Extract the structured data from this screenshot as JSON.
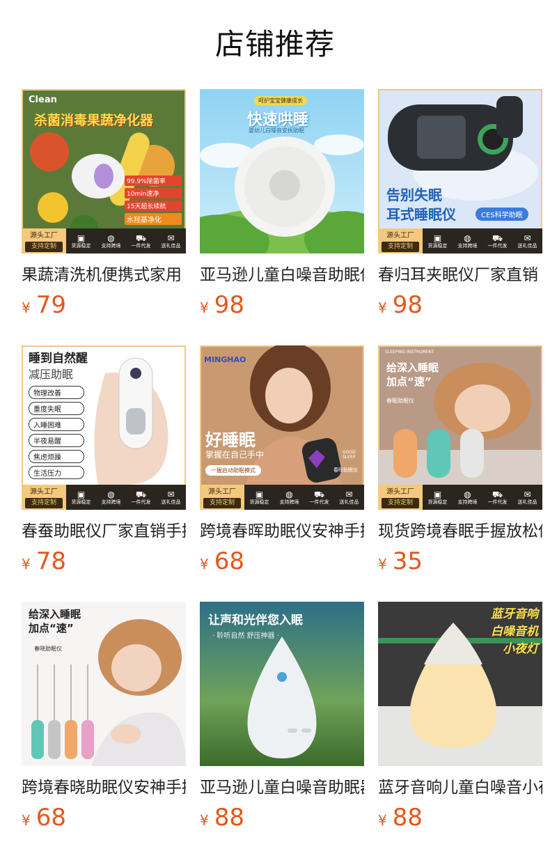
{
  "page": {
    "title": "店铺推荐"
  },
  "currency": "¥",
  "badge": {
    "line1": "源头工厂",
    "line2": "支持定制",
    "features": [
      {
        "icon": "box-icon",
        "glyph": "▣",
        "label": "货源稳定"
      },
      {
        "icon": "globe-icon",
        "glyph": "◍",
        "label": "支持跨境"
      },
      {
        "icon": "truck-icon",
        "glyph": "⛟",
        "label": "一件代发"
      },
      {
        "icon": "gift-icon",
        "glyph": "🎁",
        "label": "送礼佳品"
      }
    ]
  },
  "products": [
    {
      "name": "果蔬清洗机便携式家用",
      "price": "79",
      "overlay": {
        "brand": "Clean",
        "headline": "杀菌消毒果蔬净化器",
        "tags": [
          "99.9%除菌率",
          "10min速净",
          "15天超长续航",
          "水羟基净化"
        ]
      }
    },
    {
      "name": "亚马逊儿童白噪音助眠仪",
      "price": "98",
      "overlay": {
        "top": "呵护宝宝健康成长",
        "headline": "快速哄睡",
        "sub": "婴幼儿白噪音安抚助眠"
      }
    },
    {
      "name": "春归耳夹眠仪厂家直销",
      "price": "98",
      "overlay": {
        "headline1": "告别失眠",
        "headline2": "耳式睡眠仪",
        "tag": "CES科学助眠"
      }
    },
    {
      "name": "春蚕助眠仪厂家直销手握",
      "price": "78",
      "overlay": {
        "headline1": "睡到自然醒",
        "headline2": "减压助眠",
        "tags": [
          "物理改善",
          "重度失眠",
          "入睡困难",
          "半夜易醒",
          "焦虑烦躁",
          "生活压力"
        ]
      }
    },
    {
      "name": "跨境春晖助眠仪安神手握",
      "price": "68",
      "overlay": {
        "brand": "MINGHAO",
        "headline": "好睡眠",
        "sub": "掌握在自己手中",
        "button": "一握启动助眠模式",
        "tag": "春晖助眠仪",
        "device": "GOOD SLEEP."
      }
    },
    {
      "name": "现货跨境春眠手握放松仪",
      "price": "35",
      "overlay": {
        "top": "SLEEPING INSTRUMENT",
        "headline1": "给深入睡眠",
        "headline2": "加点“速”",
        "sub": "春眠助眠仪"
      }
    },
    {
      "name": "跨境春晓助眠仪安神手握",
      "price": "68",
      "overlay": {
        "headline1": "给深入睡眠",
        "headline2": "加点“速”",
        "sub": "春晓助眠仪"
      }
    },
    {
      "name": "亚马逊儿童白噪音助眠器",
      "price": "88",
      "overlay": {
        "headline": "让声和光伴您入眠",
        "sub": "· 聆听自然 舒压神器 ·"
      }
    },
    {
      "name": "蓝牙音响儿童白噪音小夜灯",
      "price": "88",
      "overlay": {
        "line1": "蓝牙音响",
        "line2": "白噪音机",
        "line3": "小夜灯"
      }
    }
  ]
}
